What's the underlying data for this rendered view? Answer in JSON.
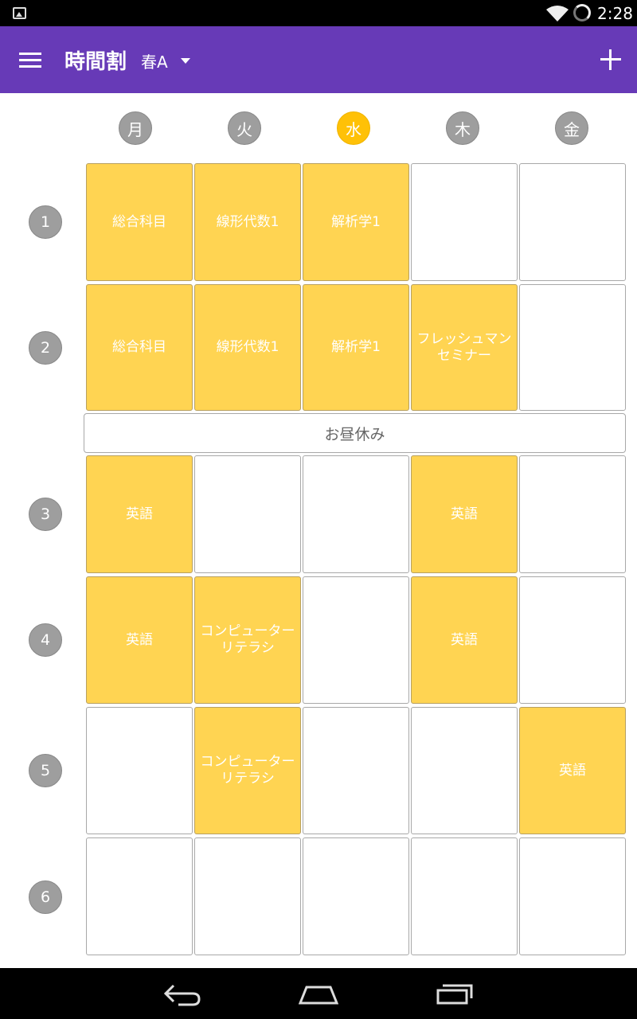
{
  "status_bar": {
    "time": "2:28"
  },
  "app_bar": {
    "title": "時間割",
    "term": "春A"
  },
  "days": [
    {
      "label": "月",
      "today": false
    },
    {
      "label": "火",
      "today": false
    },
    {
      "label": "水",
      "today": true
    },
    {
      "label": "木",
      "today": false
    },
    {
      "label": "金",
      "today": false
    }
  ],
  "lunch_label": "お昼休み",
  "periods": [
    {
      "label": "1",
      "cells": [
        "総合科目",
        "線形代数1",
        "解析学1",
        "",
        ""
      ]
    },
    {
      "label": "2",
      "cells": [
        "総合科目",
        "線形代数1",
        "解析学1",
        "フレッシュマン\nセミナー",
        ""
      ]
    },
    {
      "label": "3",
      "cells": [
        "英語",
        "",
        "",
        "英語",
        ""
      ]
    },
    {
      "label": "4",
      "cells": [
        "英語",
        "コンピューター\nリテラシ",
        "",
        "英語",
        ""
      ]
    },
    {
      "label": "5",
      "cells": [
        "",
        "コンピューター\nリテラシ",
        "",
        "",
        "英語"
      ]
    },
    {
      "label": "6",
      "cells": [
        "",
        "",
        "",
        "",
        ""
      ]
    }
  ],
  "colors": {
    "app_bar": "#673ab7",
    "filled_cell": "#ffd452",
    "today": "#ffc107",
    "badge": "#9e9e9e"
  },
  "icons": {
    "menu": "menu-icon",
    "add": "add-icon",
    "back": "back-icon",
    "home": "home-icon",
    "recents": "recents-icon"
  }
}
